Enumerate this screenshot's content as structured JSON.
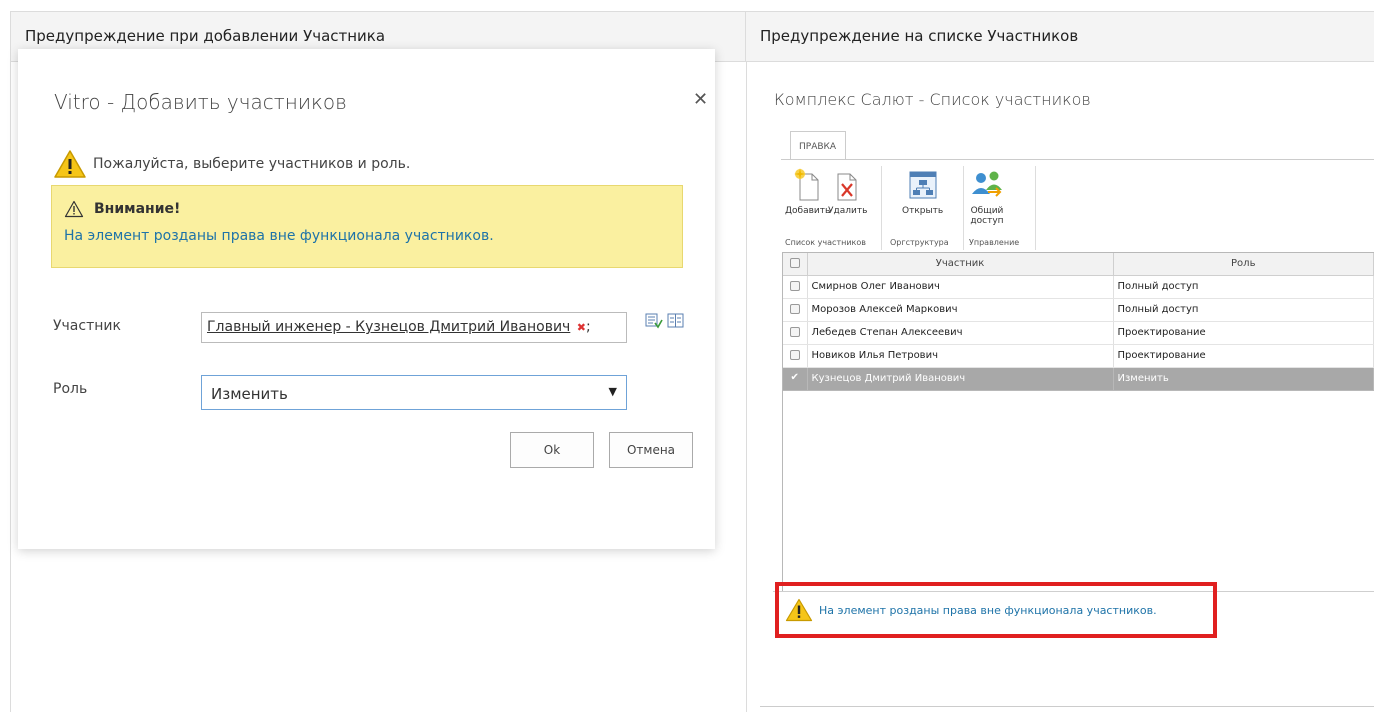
{
  "columns": {
    "left_header": "Предупреждение при добавлении Участника",
    "right_header": "Предупреждение на списке Участников"
  },
  "dialog": {
    "title": "Vitro - Добавить участников",
    "close": "✕",
    "prompt": "Пожалуйста, выберите участников и роль.",
    "notice_title": "Внимание!",
    "notice_text": "На элемент розданы права вне функционала участников.",
    "participant_label": "Участник",
    "participant_value": "Главный инженер - Кузнецов Дмитрий Иванович",
    "participant_remove": "✖",
    "participant_sep": ";",
    "role_label": "Роль",
    "role_value": "Изменить",
    "role_arrow": "▼",
    "ok": "Ok",
    "cancel": "Отмена",
    "icons": [
      "check-names-icon",
      "address-book-icon"
    ]
  },
  "list_panel": {
    "title": "Комплекс Салют - Список участников",
    "ribbon": {
      "tab": "ПРАВКА",
      "buttons": {
        "add": "Добавить",
        "delete": "Удалить",
        "open": "Открыть",
        "share_line1": "Общий",
        "share_line2": "доступ"
      },
      "groups": {
        "list": "Список участников",
        "org": "Оргструктура",
        "manage": "Управление"
      }
    },
    "grid": {
      "headers": {
        "participant": "Участник",
        "role": "Роль"
      },
      "rows": [
        {
          "name": "Смирнов  Олег Иванович",
          "role": "Полный доступ",
          "checked": ""
        },
        {
          "name": "Морозов Алексей  Маркович",
          "role": "Полный доступ",
          "checked": ""
        },
        {
          "name": "Лебедев Степан Алексеевич",
          "role": "Проектирование",
          "checked": ""
        },
        {
          "name": "Новиков Илья Петрович",
          "role": "Проектирование",
          "checked": ""
        },
        {
          "name": "Кузнецов Дмитрий Иванович",
          "role": "Изменить",
          "checked": "✔"
        }
      ],
      "selected_row_color": "#a8a8a8"
    },
    "warning_text": "На элемент розданы права вне функционала участников.",
    "highlight_color": "#e02020"
  },
  "colors": {
    "notice_bg": "#faf0a0",
    "link_blue": "#1e73a8",
    "header_bg": "#f4f4f4"
  }
}
